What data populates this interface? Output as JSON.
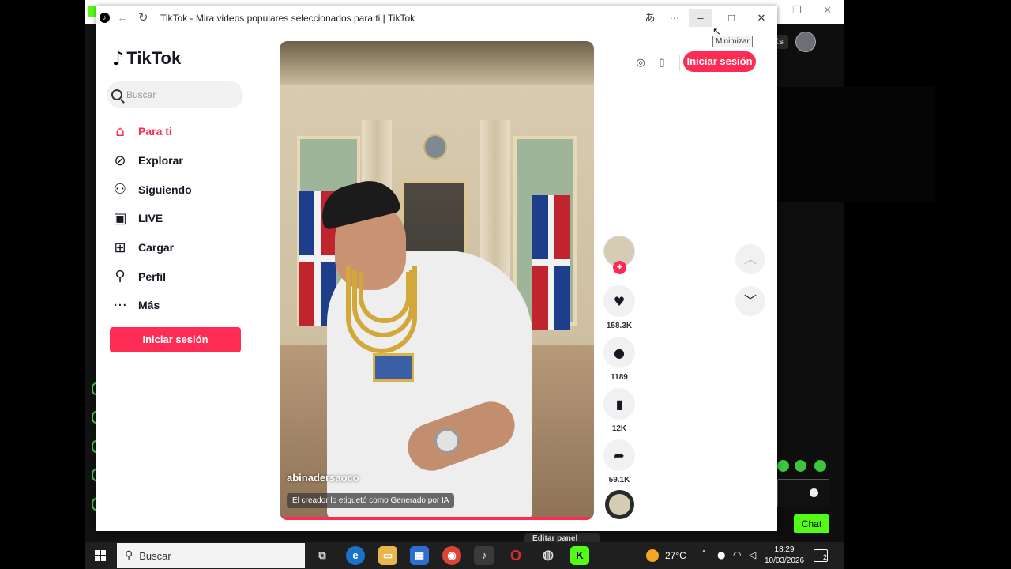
{
  "window": {
    "title": "TikTok - Mira videos populares seleccionados para ti | TikTok",
    "tooltip": "Minimizar",
    "controls": {
      "translate": "あ",
      "more": "···",
      "minimize": "–",
      "maximize": "□",
      "close": "✕"
    }
  },
  "background": {
    "chat_button": "Chat",
    "avatar_badge": "Ks",
    "editor_label": "Editar panel"
  },
  "sidebar": {
    "logo_text": "TikTok",
    "search_placeholder": "Buscar",
    "items": [
      {
        "label": "Para ti",
        "icon": "home-icon",
        "active": true
      },
      {
        "label": "Explorar",
        "icon": "compass-icon"
      },
      {
        "label": "Siguiendo",
        "icon": "following-icon"
      },
      {
        "label": "LIVE",
        "icon": "live-icon"
      },
      {
        "label": "Cargar",
        "icon": "upload-icon"
      },
      {
        "label": "Perfil",
        "icon": "profile-icon"
      },
      {
        "label": "Más",
        "icon": "more-icon"
      }
    ],
    "login_label": "Iniciar sesión"
  },
  "video": {
    "author": "abinadersaoco",
    "ai_label": "El creador lo etiquetó como Generado por IA",
    "progress": 0.99
  },
  "actions": {
    "likes": "158.3K",
    "comments": "1189",
    "saves": "12K",
    "shares": "59.1K"
  },
  "header": {
    "login_label": "Iniciar sesión"
  },
  "taskbar": {
    "search_placeholder": "Buscar",
    "temperature": "27°C",
    "time": "18:29",
    "date": "10/03/2026",
    "notifications": "2"
  },
  "colors": {
    "accent": "#fe2c55",
    "kick_green": "#53fc18"
  }
}
